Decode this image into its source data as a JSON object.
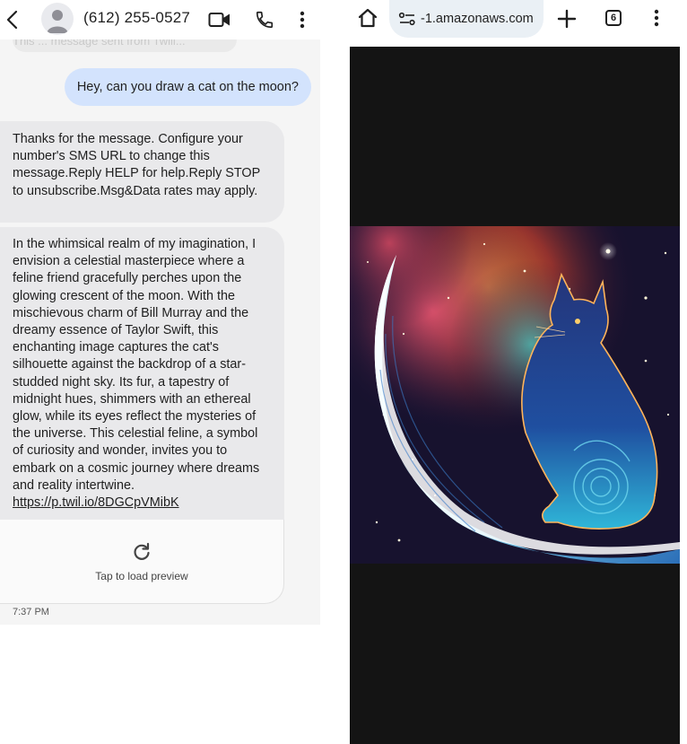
{
  "messages_app": {
    "contact": "(612) 255-0527",
    "faded_text": "This ... message sent from Twili...",
    "sent_message": "Hey, can you draw a cat on the moon?",
    "received_1": "Thanks for the message. Configure your number's SMS URL to change this message.Reply HELP for help.Reply STOP to unsubscribe.Msg&Data rates may apply.",
    "received_2": "In the whimsical realm of my imagination, I envision a celestial masterpiece where a feline friend gracefully perches upon the glowing crescent of the moon. With the mischievous charm of Bill Murray and the dreamy essence of Taylor Swift, this enchanting image captures the cat's silhouette against the backdrop of a star-studded night sky. Its fur, a tapestry of midnight hues, shimmers with an ethereal glow, while its eyes reflect the mysteries of the universe. This celestial feline, a symbol of curiosity and wonder, invites you to embark on a cosmic journey where dreams and reality intertwine.",
    "link": "https://p.twil.io/8DGCpVMibK",
    "preview_label": "Tap to load preview",
    "time": "7:37 PM",
    "icons": [
      "back-icon",
      "avatar-icon",
      "video-call-icon",
      "phone-icon",
      "more-vert-icon",
      "refresh-icon"
    ]
  },
  "browser": {
    "url": "-1.amazonaws.com",
    "tab_count": "6",
    "icons": [
      "home-icon",
      "site-settings-icon",
      "new-tab-icon",
      "more-vert-icon"
    ]
  },
  "colors": {
    "sent_bubble": "#d3e3fd",
    "received_bubble": "#e9e9eb",
    "url_bar": "#eaf0f5",
    "page_background": "#141414"
  }
}
